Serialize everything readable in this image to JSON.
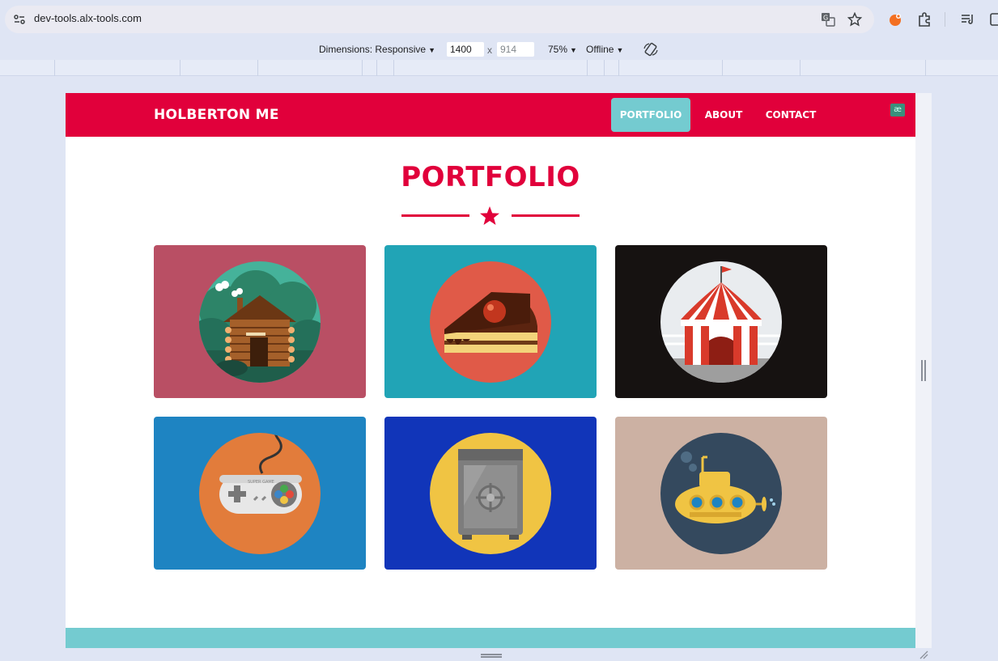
{
  "browser": {
    "url": "dev-tools.alx-tools.com"
  },
  "device_toolbar": {
    "dimensions_label": "Dimensions: Responsive",
    "width_value": "1400",
    "times": "x",
    "height_value": "914",
    "zoom": "75%",
    "throttle": "Offline"
  },
  "site": {
    "brand": "HOLBERTON ME",
    "nav": [
      {
        "label": "PORTFOLIO",
        "active": true
      },
      {
        "label": "ABOUT",
        "active": false
      },
      {
        "label": "CONTACT",
        "active": false
      }
    ],
    "extension_badge": "æ"
  },
  "portfolio": {
    "title": "PORTFOLIO",
    "cards": [
      {
        "icon": "log-cabin-icon",
        "bg": "#b94f64",
        "disc": "#45b29a"
      },
      {
        "icon": "cake-slice-icon",
        "bg": "#21a4b6",
        "disc": "#e05a48"
      },
      {
        "icon": "circus-tent-icon",
        "bg": "#161211",
        "disc": "#e9ecef"
      },
      {
        "icon": "game-controller-icon",
        "bg": "#1e84c2",
        "disc": "#e27c3b"
      },
      {
        "icon": "safe-icon",
        "bg": "#1135b9",
        "disc": "#f0c443"
      },
      {
        "icon": "submarine-icon",
        "bg": "#ccb1a3",
        "disc": "#34495e"
      }
    ]
  },
  "colors": {
    "brand_red": "#e1003b",
    "accent_teal": "#74cbd0"
  }
}
